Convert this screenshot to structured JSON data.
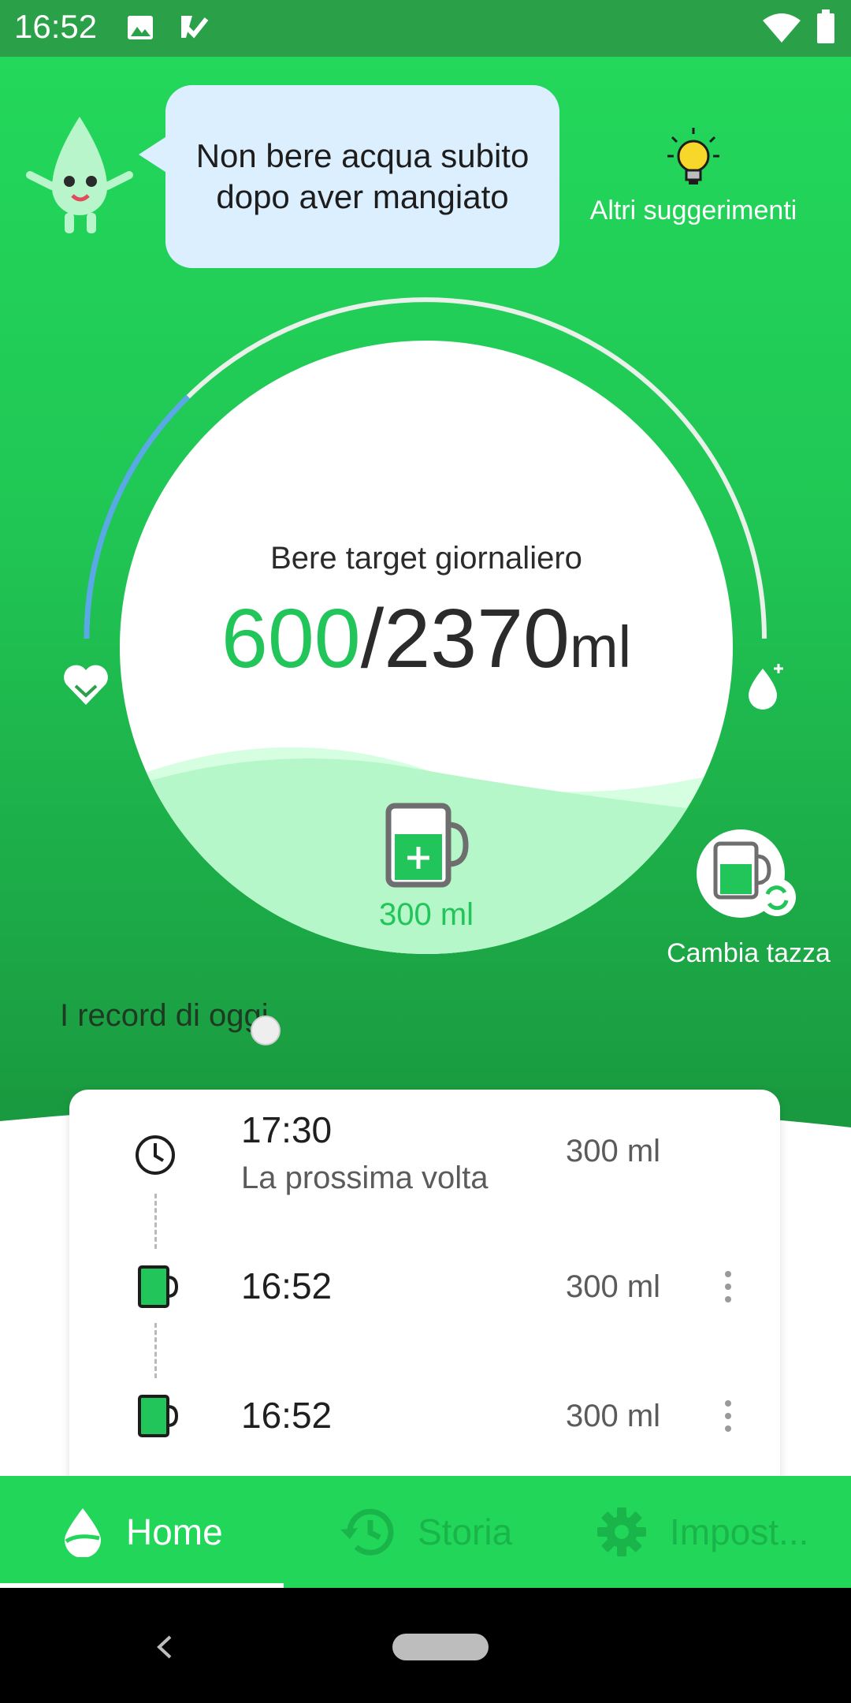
{
  "status_bar": {
    "time": "16:52"
  },
  "tip": {
    "text": "Non bere acqua subito dopo aver mangiato",
    "more_label": "Altri suggerimenti"
  },
  "progress": {
    "label": "Bere target giornaliero",
    "current": "600",
    "separator": "/",
    "target": "2370",
    "unit": "ml",
    "fraction": 0.253
  },
  "cup": {
    "amount": "300 ml",
    "change_label": "Cambia tazza"
  },
  "records": {
    "title": "I record di oggi",
    "items": [
      {
        "time": "17:30",
        "subtitle": "La prossima volta",
        "amount": "300 ml",
        "kind": "reminder"
      },
      {
        "time": "16:52",
        "subtitle": "",
        "amount": "300 ml",
        "kind": "drink"
      },
      {
        "time": "16:52",
        "subtitle": "",
        "amount": "300 ml",
        "kind": "drink"
      }
    ]
  },
  "nav": {
    "home": "Home",
    "history": "Storia",
    "settings": "Impost..."
  },
  "colors": {
    "accent": "#22c55a",
    "nav_bg": "#22d65a",
    "bubble": "#dcefff",
    "progress_arc": "#5aa8e6"
  },
  "icons": {
    "mascot": "water-drop-mascot-icon",
    "tips": "lightbulb-icon",
    "heart": "heart-icon",
    "drop": "water-drop-icon",
    "cup": "cup-icon",
    "history": "history-icon",
    "settings": "gear-icon"
  }
}
